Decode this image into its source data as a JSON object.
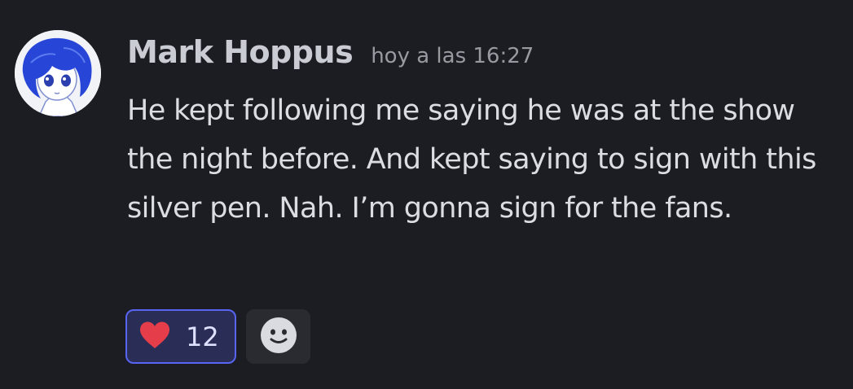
{
  "message": {
    "author": "Mark Hoppus",
    "timestamp": "hoy a las 16:27",
    "content": "He kept following me saying he was at the show the night before. And kept saying to sign with this silver pen. Nah. I’m gonna sign for the fans."
  },
  "reactions": [
    {
      "emoji": "heart-icon",
      "count": "12",
      "selected": true
    }
  ],
  "add_reaction": {
    "icon": "smiley-icon"
  },
  "colors": {
    "background": "#1c1d22",
    "author": "#c9ccd3",
    "timestamp": "#989aa2",
    "text": "#dcdde2",
    "reaction_bg": "#2a2e56",
    "reaction_border": "#5865f2",
    "heart": "#e53e4a"
  }
}
